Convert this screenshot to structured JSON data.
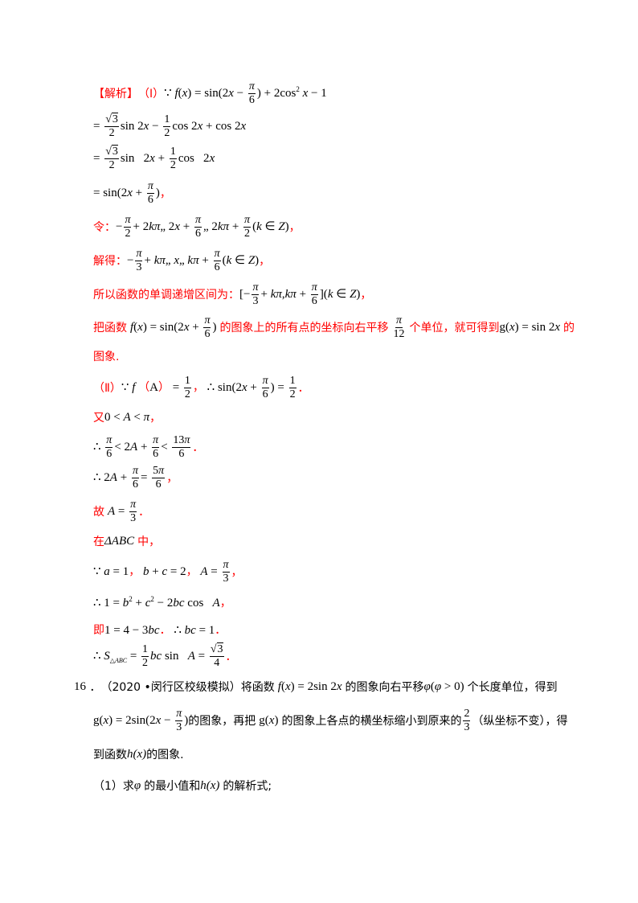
{
  "solution": {
    "header_label": "【解析】",
    "part1_label": "（Ⅰ）",
    "because": "∵",
    "therefore": "∴",
    "lines": {
      "l1_expr": "f(x) = sin(2x − π/6) + 2cos²x − 1",
      "l2_expr": "= (√3/2)sin2x − (1/2)cos2x + cos2x",
      "l3_expr": "= (√3/2)sin 2x + (1/2)cos 2x",
      "l4_expr": "= sin(2x + π/6)",
      "l5_label": "令：",
      "l5_expr": "−π/2 + 2kπ ≤ 2x + π/6 ≤ 2kπ + π/2 (k∈Z)",
      "l6_label": "解得：",
      "l6_expr": "−π/3 + kπ ≤ x ≤ kπ + π/6 (k∈Z)",
      "l7_label": "所以函数的单调递增区间为：",
      "l7_expr": "[−π/3 + kπ, kπ + π/6](k∈Z)",
      "l8_text_a": "把函数",
      "l8_expr_a": "f(x) = sin(2x + π/6)",
      "l8_text_b": "的图象上的所有点的坐标向右平移",
      "l8_expr_b": "π/12",
      "l8_text_c": "个单位，就可得到",
      "l8_expr_c": "g(x) = sin2x",
      "l8_text_d": "的",
      "l9_text": "图象.",
      "l10_label": "（Ⅱ）",
      "l10_expr": "∵ f (A) = 1/2， ∴ sin(2x + π/6) = 1/2",
      "l11_label": "又",
      "l11_expr": "0 < A < π",
      "l12_expr": "∴ π/6 < 2A + π/6 < 13π/6",
      "l13_expr": "∴ 2A + π/6 = 5π/6",
      "l14_label": "故",
      "l14_expr": "A = π/3",
      "l15_label_a": "在",
      "l15_expr": "ΔABC",
      "l15_label_b": "中",
      "l16_expr": "∵ a = 1， b + c = 2， A = π/3",
      "l17_expr": "∴ 1 = b² + c² − 2bc cos A",
      "l18_label": "即",
      "l18_expr": "1 = 4 − 3bc ． ∴ bc = 1",
      "l19_expr": "∴ S△ABC = (1/2)bc sin A = √3/4"
    }
  },
  "problem16": {
    "number": "16",
    "source": "（2020 •闵行区校级模拟）",
    "line1_text_a": "将函数",
    "line1_expr_a": "f(x) = 2sin2x",
    "line1_text_b": "的图象向右平移",
    "line1_expr_b": "φ(φ > 0)",
    "line1_text_c": "个长度单位，得到",
    "line2_expr_a": "g(x) = 2sin(2x − π/3)",
    "line2_text_a": "的图象，再把",
    "line2_expr_b": "g(x)",
    "line2_text_b": "的图象上各点的横坐标缩小到原来的",
    "line2_expr_c": "2/3",
    "line2_text_c": "（纵坐标不变），得",
    "line3_text_a": "到函数",
    "line3_expr_a": "h(x)",
    "line3_text_b": "的图象.",
    "q1_label": "（1）",
    "q1_text_a": "求",
    "q1_expr_a": "φ",
    "q1_text_b": "的最小值和",
    "q1_expr_b": "h(x)",
    "q1_text_c": "的解析式;"
  },
  "colors": {
    "highlight": "#ff0000",
    "text": "#000000"
  }
}
